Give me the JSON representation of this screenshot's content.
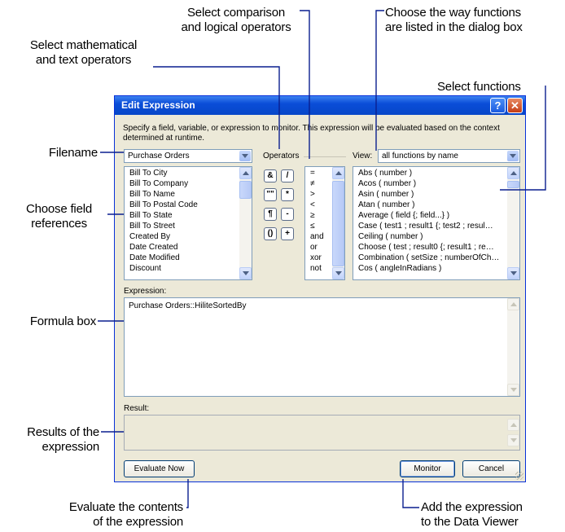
{
  "callouts": {
    "select_comparison": [
      "Select comparison",
      "and logical operators"
    ],
    "choose_listing": [
      "Choose the way functions",
      "are listed in the dialog box"
    ],
    "select_math": [
      "Select mathematical",
      "and text operators"
    ],
    "select_functions": "Select functions",
    "filename": "Filename",
    "choose_field": [
      "Choose field",
      "references"
    ],
    "formula_box": "Formula box",
    "results": [
      "Results of the",
      "expression"
    ],
    "evaluate": [
      "Evaluate the contents",
      "of the expression"
    ],
    "add_expression": [
      "Add the expression",
      "to the Data Viewer"
    ]
  },
  "dialog": {
    "title": "Edit Expression",
    "help_glyph": "?",
    "close_glyph": "✕",
    "instructions": "Specify a field, variable, or expression to monitor. This expression will be evaluated based on the context determined at runtime.",
    "table_select": "Purchase Orders",
    "operators_label": "Operators",
    "view_label": "View:",
    "view_select": "all functions by name",
    "fields": [
      "Bill To City",
      "Bill To Company",
      "Bill To Name",
      "Bill To Postal Code",
      "Bill To State",
      "Bill To Street",
      "Created By",
      "Date Created",
      "Date Modified",
      "Discount"
    ],
    "math_operators": [
      "&",
      "/",
      "\"\"",
      "*",
      "¶",
      "-",
      "()",
      "+"
    ],
    "comparison_operators": [
      "=",
      "≠",
      ">",
      "<",
      "≥",
      "≤",
      "and",
      "or",
      "xor",
      "not"
    ],
    "functions": [
      "Abs ( number )",
      "Acos ( number )",
      "Asin ( number )",
      "Atan ( number )",
      "Average ( field {; field...} )",
      "Case ( test1 ; result1 {; test2 ; resul…",
      "Ceiling ( number )",
      "Choose ( test ; result0 {; result1 ; re…",
      "Combination ( setSize ; numberOfCh…",
      "Cos ( angleInRadians )"
    ],
    "expression_label": "Expression:",
    "expression_value": "Purchase Orders::HiliteSortedBy",
    "result_label": "Result:",
    "evaluate_button": "Evaluate Now",
    "monitor_button": "Monitor",
    "cancel_button": "Cancel"
  },
  "colors": {
    "callout_line": "#0a1f8f",
    "titlebar": "#0a4dd8",
    "dialog_bg": "#ece9d8"
  }
}
